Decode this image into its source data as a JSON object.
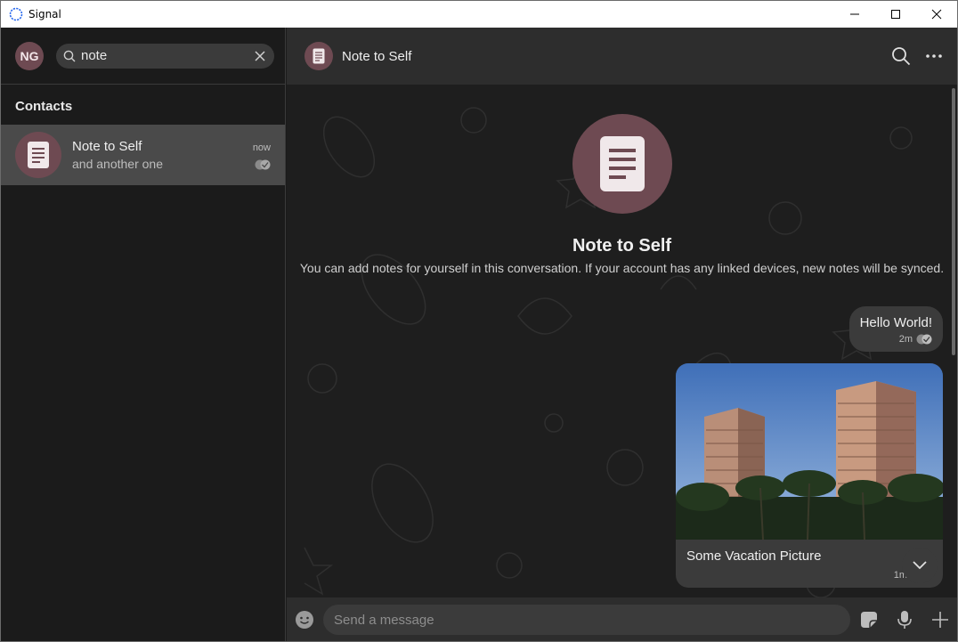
{
  "window": {
    "title": "Signal"
  },
  "sidebar": {
    "avatar_initials": "NG",
    "search": {
      "value": "note",
      "placeholder": "Search"
    },
    "section_label": "Contacts",
    "contacts": [
      {
        "name": "Note to Self",
        "preview": "and another one",
        "time": "now"
      }
    ]
  },
  "conversation": {
    "title": "Note to Self",
    "hero": {
      "title": "Note to Self",
      "subtitle": "You can add notes for yourself in this conversation. If your account has any linked devices, new notes will be synced."
    },
    "messages": [
      {
        "type": "text",
        "text": "Hello World!",
        "time": "2m"
      },
      {
        "type": "image",
        "caption": "Some Vacation Picture",
        "time": "1m"
      }
    ],
    "composer": {
      "placeholder": "Send a message"
    }
  },
  "colors": {
    "accent_avatar": "#6e4a52",
    "panel": "#2d2d2d",
    "bubble": "#3b3b3b",
    "selected_row": "#4a4a4a"
  }
}
